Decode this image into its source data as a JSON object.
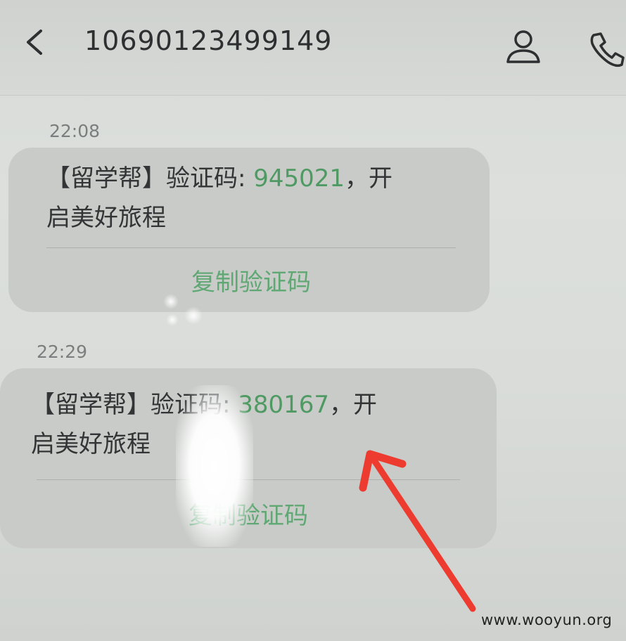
{
  "header": {
    "back_icon": "chevron-left-icon",
    "title": "10690123499149",
    "contact_icon": "person-icon",
    "call_icon": "phone-icon"
  },
  "messages": [
    {
      "time": "22:08",
      "prefix": "【留学帮】验证码: ",
      "code": "945021",
      "suffix_line1": "，开",
      "line2": "启美好旅程",
      "copy_label": "复制验证码"
    },
    {
      "time": "22:29",
      "prefix": "【留学帮】验证码: ",
      "code": "380167",
      "suffix_line1": "，开",
      "line2": "启美好旅程",
      "copy_label": "复制验证码"
    }
  ],
  "annotation": {
    "arrow_color": "#ee3b2f"
  },
  "watermark": "www.wooyun.org",
  "colors": {
    "code_green": "#4f9a63",
    "copy_green": "#5fa873",
    "bubble": "#c8cbc8",
    "text": "#323436"
  }
}
